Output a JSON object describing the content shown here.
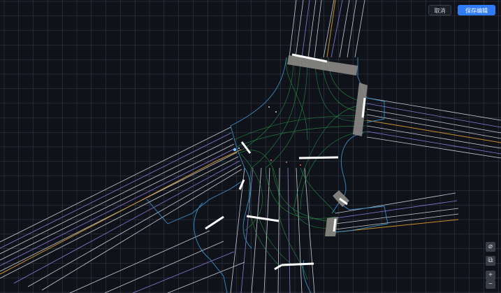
{
  "toolbar": {
    "cancel_label": "取消",
    "save_label": "保存编辑"
  },
  "side_tools": [
    {
      "name": "eraser-icon",
      "glyph": "⌀"
    },
    {
      "name": "copy-icon",
      "glyph": "⧉"
    },
    {
      "name": "zoom-in-icon",
      "glyph": "+"
    },
    {
      "name": "zoom-out-icon",
      "glyph": "−"
    }
  ],
  "colors": {
    "background": "#0f1219",
    "grid": "#3a3f4a",
    "lane_white": "#c8ccd6",
    "lane_purple": "#8f7ad6",
    "centerline": "#c9902a",
    "road_edge": "#3a8fc6",
    "connector": "#27a34a",
    "crosswalk": "#8c8a86",
    "accent": "#2f7cf6"
  }
}
